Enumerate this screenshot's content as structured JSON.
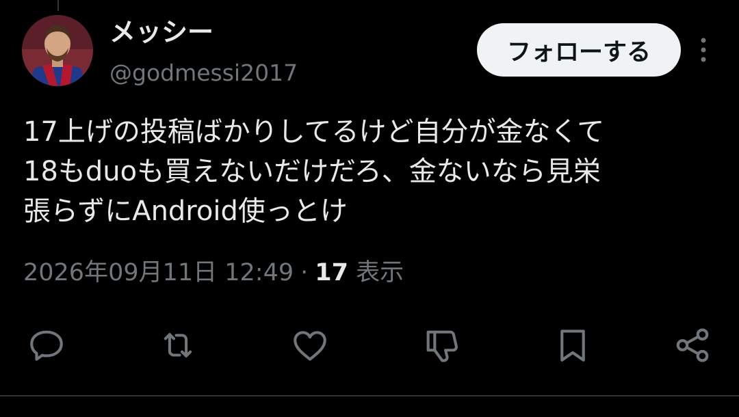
{
  "user": {
    "display_name": "メッシー",
    "handle": "@godmessi2017",
    "avatar_icon": "avatar-photo"
  },
  "follow_button": {
    "label": "フォローする"
  },
  "more_button": {
    "icon": "more-vertical-icon"
  },
  "tweet": {
    "text_lines": [
      "17上げの投稿ばかりしてるけど自分が金なくて",
      "18もduoも買えないだけだろ、金ないなら見栄",
      "張らずにAndroid使っとけ"
    ]
  },
  "meta": {
    "timestamp": "2026年09月11日 12:49",
    "separator": "·",
    "view_count": "17",
    "view_label": "表示"
  },
  "actions": [
    {
      "icon": "reply-icon"
    },
    {
      "icon": "retweet-icon"
    },
    {
      "icon": "like-icon"
    },
    {
      "icon": "dislike-icon"
    },
    {
      "icon": "bookmark-icon"
    },
    {
      "icon": "share-icon"
    }
  ],
  "colors": {
    "background": "#000000",
    "text_primary": "#e7e9ea",
    "text_secondary": "#71767b",
    "follow_bg": "#eff3f4",
    "follow_text": "#0f1419",
    "divider": "#2f3336"
  }
}
